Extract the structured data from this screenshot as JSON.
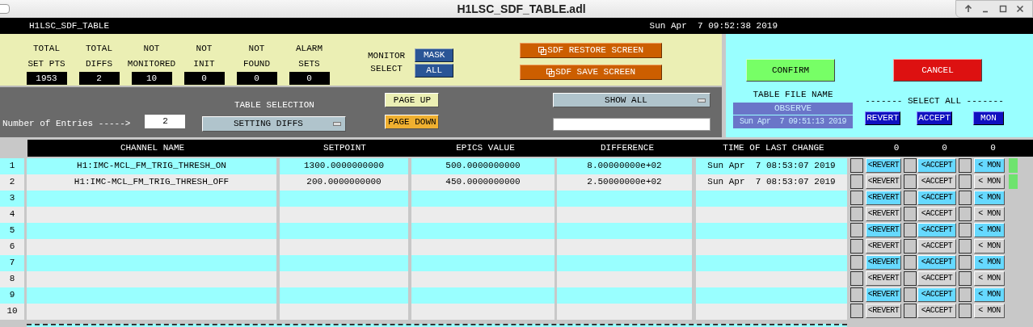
{
  "window": {
    "title": "H1LSC_SDF_TABLE.adl"
  },
  "header_bar": {
    "title": "H1LSC_SDF_TABLE",
    "datetime": "Sun Apr  7 09:52:38 2019"
  },
  "stats": [
    {
      "label": [
        "TOTAL",
        "SET PTS"
      ],
      "value": "1953"
    },
    {
      "label": [
        "TOTAL",
        "DIFFS"
      ],
      "value": "2"
    },
    {
      "label": [
        "NOT",
        "MONITORED"
      ],
      "value": "10"
    },
    {
      "label": [
        "NOT",
        "INIT"
      ],
      "value": "0"
    },
    {
      "label": [
        "NOT",
        "FOUND"
      ],
      "value": "0"
    },
    {
      "label": [
        "ALARM",
        "SETS"
      ],
      "value": "0"
    }
  ],
  "monitor_select": {
    "label": [
      "MONITOR",
      "SELECT"
    ],
    "options": [
      "MASK",
      "ALL"
    ]
  },
  "screen_buttons": [
    "SDF RESTORE SCREEN",
    "SDF SAVE SCREEN"
  ],
  "entries": {
    "label": "Number of Entries ----->",
    "value": "2"
  },
  "table_selection": {
    "label": "TABLE SELECTION",
    "value": "SETTING DIFFS"
  },
  "page_buttons": [
    {
      "label": "PAGE UP",
      "highlighted": false
    },
    {
      "label": "PAGE DOWN",
      "highlighted": true
    }
  ],
  "filter": {
    "value": "SHOW ALL"
  },
  "actions": [
    {
      "label": "CONFIRM",
      "kind": "confirm"
    },
    {
      "label": "CANCEL",
      "kind": "cancel"
    }
  ],
  "table_file": {
    "label": "TABLE FILE NAME",
    "name": "OBSERVE",
    "timestamp": "Sun Apr  7 09:51:13 2019"
  },
  "select_all": {
    "label": "------- SELECT ALL -------",
    "buttons": [
      "REVERT",
      "ACCEPT",
      "MON"
    ]
  },
  "table": {
    "columns": [
      "CHANNEL NAME",
      "SETPOINT",
      "EPICS VALUE",
      "DIFFERENCE",
      "TIME OF LAST CHANGE"
    ],
    "counts": [
      "0",
      "0",
      "0"
    ],
    "rows": [
      {
        "number": "1",
        "channel": "H1:IMC-MCL_FM_TRIG_THRESH_ON",
        "setpoint": "1300.0000000000",
        "epics_value": "500.0000000000",
        "difference": "8.00000000e+02",
        "time": "Sun Apr  7 08:53:07 2019",
        "buttons": [
          "<REVERT",
          "<ACCEPT",
          "< MON"
        ],
        "checks": [
          false,
          false,
          false
        ],
        "active": true
      },
      {
        "number": "2",
        "channel": "H1:IMC-MCL_FM_TRIG_THRESH_OFF",
        "setpoint": "200.0000000000",
        "epics_value": "450.0000000000",
        "difference": "2.50000000e+02",
        "time": "Sun Apr  7 08:53:07 2019",
        "buttons": [
          "<REVERT",
          "<ACCEPT",
          "< MON"
        ],
        "checks": [
          false,
          false,
          false
        ],
        "active": true
      },
      {
        "number": "3",
        "buttons": [
          "<REVERT",
          "<ACCEPT",
          "< MON"
        ],
        "checks": [
          false,
          false,
          false
        ],
        "active": false
      },
      {
        "number": "4",
        "buttons": [
          "<REVERT",
          "<ACCEPT",
          "< MON"
        ],
        "checks": [
          false,
          false,
          false
        ],
        "active": false
      },
      {
        "number": "5",
        "buttons": [
          "<REVERT",
          "<ACCEPT",
          "< MON"
        ],
        "checks": [
          false,
          false,
          false
        ],
        "active": false
      },
      {
        "number": "6",
        "buttons": [
          "<REVERT",
          "<ACCEPT",
          "< MON"
        ],
        "checks": [
          false,
          false,
          false
        ],
        "active": false
      },
      {
        "number": "7",
        "buttons": [
          "<REVERT",
          "<ACCEPT",
          "< MON"
        ],
        "checks": [
          false,
          false,
          false
        ],
        "active": false
      },
      {
        "number": "8",
        "buttons": [
          "<REVERT",
          "<ACCEPT",
          "< MON"
        ],
        "checks": [
          false,
          false,
          false
        ],
        "active": false
      },
      {
        "number": "9",
        "buttons": [
          "<REVERT",
          "<ACCEPT",
          "< MON"
        ],
        "checks": [
          false,
          false,
          false
        ],
        "active": false
      },
      {
        "number": "10",
        "buttons": [
          "<REVERT",
          "<ACCEPT",
          "< MON"
        ],
        "checks": [
          false,
          false,
          false
        ],
        "active": false
      }
    ]
  }
}
